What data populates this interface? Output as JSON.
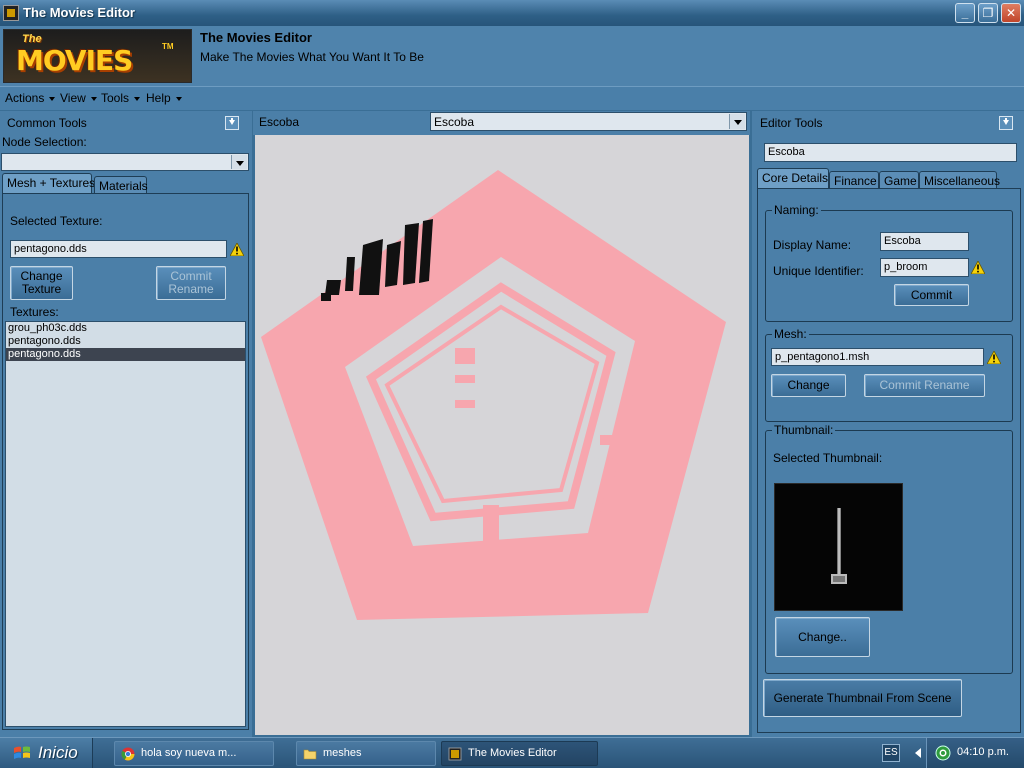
{
  "window": {
    "title": "The Movies Editor",
    "controls": {
      "minimize": "_",
      "maximize": "❐",
      "close": "✕"
    }
  },
  "banner": {
    "logo_the": "The",
    "logo_movies": "MOVIES",
    "logo_tm": "TM",
    "app_name": "The Movies Editor",
    "tagline": "Make The Movies What You Want It To Be"
  },
  "menu": [
    "Actions",
    "View",
    "Tools",
    "Help"
  ],
  "common_tools": {
    "title": "Common Tools",
    "node_selection_label": "Node Selection:",
    "node_selection_value": "",
    "tabs": [
      "Mesh + Textures",
      "Materials"
    ],
    "selected_texture_label": "Selected Texture:",
    "selected_texture_value": "pentagono.dds",
    "change_texture_label": "Change Texture",
    "commit_rename_label": "Commit Rename",
    "textures_label": "Textures:",
    "textures": [
      "grou_ph03c.dds",
      "pentagono.dds",
      "pentagono.dds"
    ],
    "selected_texture_index": 2
  },
  "center": {
    "object_label": "Escoba",
    "object_combo_value": "Escoba"
  },
  "editor_tools": {
    "title": "Editor Tools",
    "object_name": "Escoba",
    "tabs": [
      "Core Details",
      "Finance",
      "Game",
      "Miscellaneous"
    ],
    "naming": {
      "legend": "Naming:",
      "display_name_label": "Display Name:",
      "display_name_value": "Escoba",
      "unique_id_label": "Unique Identifier:",
      "unique_id_value": "p_broom",
      "commit_label": "Commit"
    },
    "mesh": {
      "legend": "Mesh:",
      "value": "p_pentagono1.msh",
      "change_label": "Change",
      "commit_rename_label": "Commit Rename"
    },
    "thumbnail": {
      "legend": "Thumbnail:",
      "selected_label": "Selected Thumbnail:",
      "change_label": "Change.."
    },
    "generate_label": "Generate Thumbnail  From Scene"
  },
  "taskbar": {
    "start_label": "Inicio",
    "tasks": [
      {
        "label": "hola soy nueva m...",
        "icon": "chrome-icon"
      },
      {
        "label": "meshes",
        "icon": "folder-icon"
      },
      {
        "label": "The Movies Editor",
        "icon": "movies-editor-icon"
      }
    ],
    "active_task_index": 2,
    "language": "ES",
    "clock": "04:10 p.m."
  },
  "colors": {
    "window_blue": "#4b7fa8",
    "viewport_bg": "#d6d5d8",
    "pentagon_pink": "#f7a6ae",
    "warning_yellow": "#f5d20a"
  }
}
